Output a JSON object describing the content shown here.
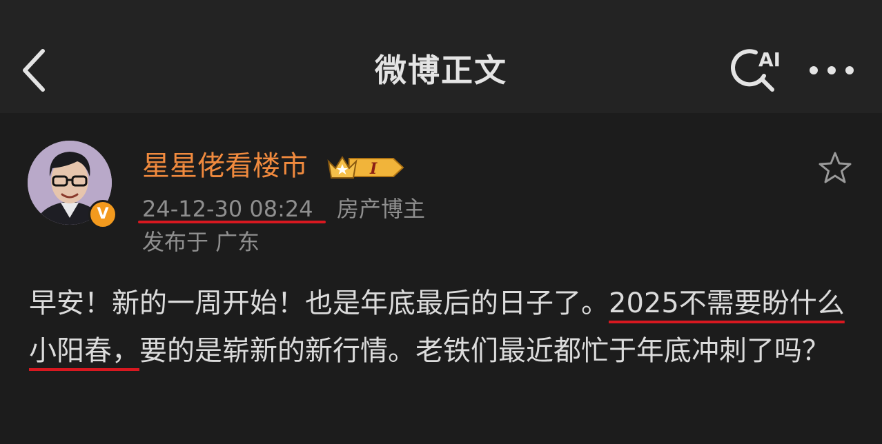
{
  "header": {
    "title": "微博正文",
    "back_icon": "chevron-left-icon",
    "ai_search_label": "AI",
    "more_icon": "more-horizontal-icon"
  },
  "post": {
    "author": {
      "name": "星星佬看楼市",
      "verified_mark": "V",
      "rank_badge_label": "I",
      "avatar_icon": "avatar-portrait"
    },
    "timestamp": "24-12-30 08:24",
    "author_tag": "房产博主",
    "location": "发布于 广东",
    "body_parts": [
      "早安！新的一周开始！也是年底最后的日子了。",
      "2025不需要盼什么小阳春，",
      "要的是崭新的新行情。老铁们最近都忙于年底冲刺了吗？"
    ]
  },
  "colors": {
    "background": "#1c1c1c",
    "header_background": "#232323",
    "username": "#f08a3e",
    "muted_text": "#8f8f8f",
    "body_text": "#dcdcdc",
    "annotation_underline": "#d81820",
    "verified_badge": "#f39a1e"
  }
}
